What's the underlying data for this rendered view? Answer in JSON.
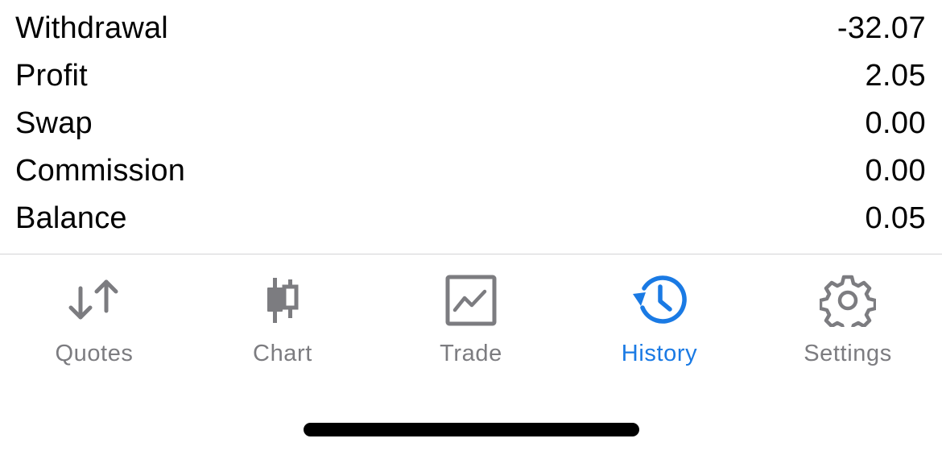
{
  "summary": {
    "rows": [
      {
        "label": "Withdrawal",
        "value": "-32.07"
      },
      {
        "label": "Profit",
        "value": "2.05"
      },
      {
        "label": "Swap",
        "value": "0.00"
      },
      {
        "label": "Commission",
        "value": "0.00"
      },
      {
        "label": "Balance",
        "value": "0.05"
      }
    ]
  },
  "tabbar": {
    "active_tab": "History",
    "colors": {
      "active": "#1a7ae4",
      "inactive": "#7c7c80"
    },
    "tabs": [
      {
        "label": "Quotes",
        "icon": "quotes-arrows-icon"
      },
      {
        "label": "Chart",
        "icon": "candlestick-chart-icon"
      },
      {
        "label": "Trade",
        "icon": "trade-chart-icon"
      },
      {
        "label": "History",
        "icon": "history-clock-icon"
      },
      {
        "label": "Settings",
        "icon": "gear-icon"
      }
    ]
  }
}
